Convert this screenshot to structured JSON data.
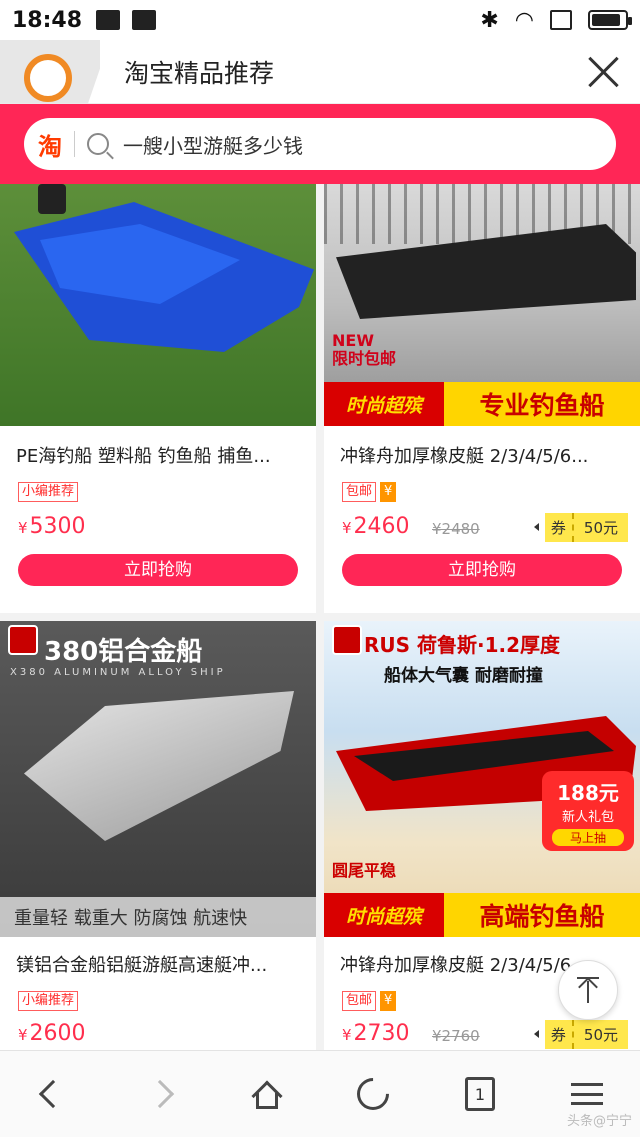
{
  "status_bar": {
    "time": "18:48"
  },
  "title_bar": {
    "title": "淘宝精品推荐"
  },
  "search": {
    "logo": "淘",
    "query": "一艘小型游艇多少钱"
  },
  "products": [
    {
      "title": "PE海钓船 塑料船 钓鱼船 捕鱼...",
      "tags": [
        "小编推荐"
      ],
      "price": "5300",
      "currency": "¥",
      "buy_label": "立即抢购"
    },
    {
      "title": "冲锋舟加厚橡皮艇 2/3/4/5/6...",
      "tags": [
        "包邮",
        "¥"
      ],
      "price": "2460",
      "old_price": "¥2480",
      "currency": "¥",
      "coupon_label": "券",
      "coupon_amount": "50元",
      "buy_label": "立即抢购",
      "image_text": {
        "new": "NEW",
        "promo": "限时包邮",
        "banner_left": "时尚超殡",
        "banner_right": "专业钓鱼船"
      }
    },
    {
      "title": "镁铝合金船铝艇游艇高速艇冲...",
      "tags": [
        "小编推荐"
      ],
      "price": "2600",
      "currency": "¥",
      "image_text": {
        "headline": "380铝合金船",
        "sub": "X380 ALUMINUM ALLOY SHIP",
        "footer": "重量轻 载重大 防腐蚀 航速快"
      }
    },
    {
      "title": "冲锋舟加厚橡皮艇 2/3/4/5/6...",
      "tags": [
        "包邮",
        "¥"
      ],
      "price": "2730",
      "old_price": "¥2760",
      "currency": "¥",
      "coupon_label": "券",
      "coupon_amount": "50元",
      "image_text": {
        "brand": "RUS 荷鲁斯·1.2厚度",
        "tagline": "船体大气囊 耐磨耐撞",
        "bottom_left": "圆尾平稳",
        "banner_left": "时尚超殡",
        "banner_right": "高端钓鱼船",
        "gift_amount": "188元",
        "gift_label": "新人礼包",
        "gift_cta": "马上抽"
      }
    }
  ],
  "bottom_nav": {
    "tab_count": "1",
    "watermark": "头条@宁宁"
  }
}
